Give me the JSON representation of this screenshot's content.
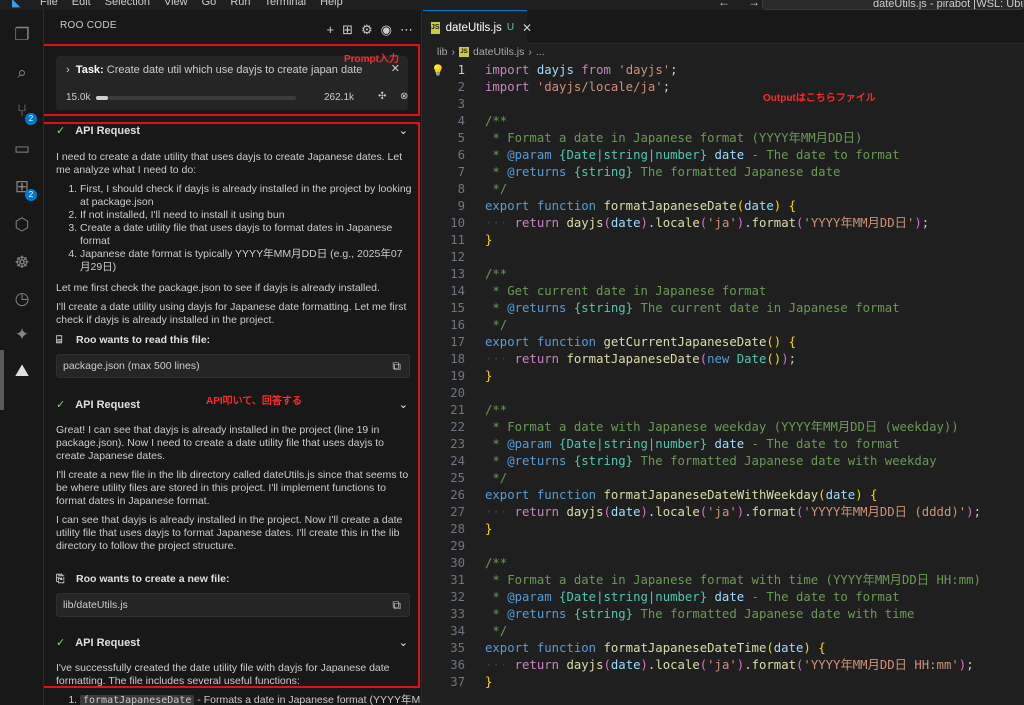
{
  "titlebar": {
    "menu": [
      "File",
      "Edit",
      "Selection",
      "View",
      "Go",
      "Run",
      "Terminal",
      "Help"
    ],
    "search_text": "dateUtils.js - pirabot [WSL: Ubuntu] - V"
  },
  "sidebar": {
    "title": "ROO CODE",
    "prompt_annotation": "Prompt入力",
    "task": {
      "label": "Task:",
      "text": "Create date util which use dayjs to create japan date",
      "tokens_used": "15.0k",
      "tokens_max": "262.1k",
      "context_fraction": 0.06
    },
    "api_annotation": "API叩いて、回答する",
    "api1": {
      "title": "API Request",
      "intro": "I need to create a date utility that uses dayjs to create Japanese dates. Let me analyze what I need to do:",
      "steps": [
        "First, I should check if dayjs is already installed in the project by looking at package.json",
        "If not installed, I'll need to install it using bun",
        "Create a date utility file that uses dayjs to format dates in Japanese format",
        "Japanese date format is typically YYYY年MM月DD日 (e.g., 2025年07月29日)"
      ],
      "p1": "Let me first check the package.json to see if dayjs is already installed.",
      "p2": "I'll create a date utility using dayjs for Japanese date formatting. Let me first check if dayjs is already installed in the project."
    },
    "read_tool": {
      "title": "Roo wants to read this file:",
      "file": "package.json (max 500 lines)"
    },
    "api2": {
      "title": "API Request",
      "p1": "Great! I can see that dayjs is already installed in the project (line 19 in package.json). Now I need to create a date utility file that uses dayjs to create Japanese dates.",
      "p2": "I'll create a new file in the lib directory called dateUtils.js since that seems to be where utility files are stored in this project. I'll implement functions to format dates in Japanese format.",
      "p3": "I can see that dayjs is already installed in the project. Now I'll create a date utility file that uses dayjs to format Japanese dates. I'll create this in the lib directory to follow the project structure."
    },
    "create_tool": {
      "title": "Roo wants to create a new file:",
      "file": "lib/dateUtils.js"
    },
    "api3": {
      "title": "API Request",
      "p1": "I've successfully created the date utility file with dayjs for Japanese date formatting. The file includes several useful functions:",
      "item1_code": "formatJapaneseDate",
      "item1_text": " - Formats a date in Japanese format (YYYY年MM"
    }
  },
  "editor": {
    "tab_label": "dateUtils.js",
    "tab_status": "U",
    "breadcrumb": [
      "lib",
      "dateUtils.js",
      "..."
    ],
    "output_annotation": "Outputはこちらファイル",
    "line_numbers": [
      "1",
      "2",
      "3",
      "4",
      "5",
      "6",
      "7",
      "8",
      "9",
      "10",
      "11",
      "12",
      "13",
      "14",
      "15",
      "16",
      "17",
      "18",
      "19",
      "20",
      "21",
      "22",
      "23",
      "24",
      "25",
      "26",
      "27",
      "28",
      "29",
      "30",
      "31",
      "32",
      "33",
      "34",
      "35",
      "36",
      "37"
    ]
  }
}
